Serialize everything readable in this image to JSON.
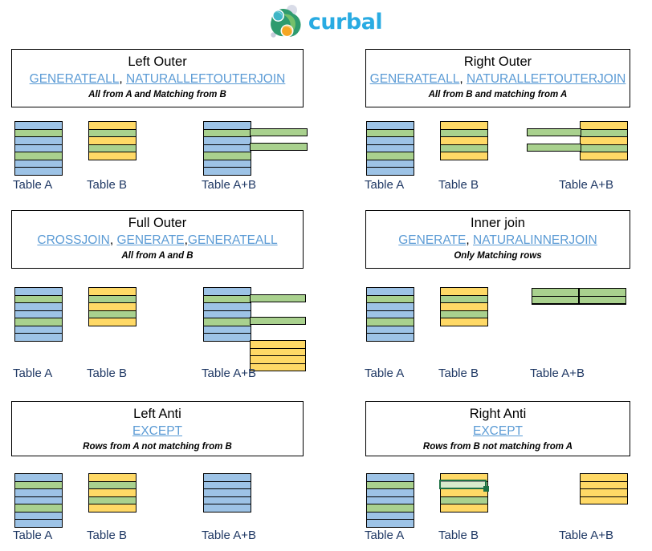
{
  "brand": {
    "name": "curbal",
    "logo_icon": "curbal-logo-icon",
    "text_color": "#29ABE2"
  },
  "palette": {
    "table_a": "#9DC3E6",
    "table_b": "#FFD966",
    "matching": "#A9D18E",
    "link": "#5B9BD5",
    "caption": "#1F3864",
    "selection": "#1E7145"
  },
  "captions": {
    "table_a": "Table A",
    "table_b": "Table B",
    "table_ab": "Table A+B"
  },
  "joins": [
    {
      "id": "left-outer",
      "title": "Left Outer",
      "functions": [
        "GENERATEALL",
        "NATURALLEFTOUTERJOIN"
      ],
      "functions_text": "GENERATEALL, NATURALLEFTOUTERJOIN",
      "description": "All from A and Matching from B",
      "table_a_rows": [
        "blue",
        "green",
        "blue",
        "blue",
        "green",
        "blue",
        "blue"
      ],
      "table_b_rows": [
        "yellow",
        "green",
        "yellow",
        "green",
        "yellow"
      ],
      "result_rows": [
        "blue",
        "green",
        "blue",
        "blue",
        "green",
        "blue",
        "blue"
      ],
      "result_extension_rows": [
        2,
        4
      ],
      "result_extra_block": null
    },
    {
      "id": "right-outer",
      "title": "Right Outer",
      "functions": [
        "GENERATEALL",
        "NATURALLEFTOUTERJOIN"
      ],
      "functions_text": "GENERATEALL, NATURALLEFTOUTERJOIN",
      "description": "All from B and matching from A",
      "table_a_rows": [
        "blue",
        "green",
        "blue",
        "blue",
        "green",
        "blue",
        "blue"
      ],
      "table_b_rows": [
        "yellow",
        "green",
        "yellow",
        "green",
        "yellow"
      ],
      "result_rows": [
        "yellow",
        "green",
        "yellow",
        "green",
        "yellow"
      ],
      "result_extension_rows": [
        2,
        4
      ],
      "result_extra_block": null
    },
    {
      "id": "full-outer",
      "title": "Full Outer",
      "functions": [
        "CROSSJOIN",
        "GENERATE",
        "GENERATEALL"
      ],
      "functions_text": "CROSSJOIN, GENERATE,GENERATEALL",
      "description": "All from A and B",
      "table_a_rows": [
        "blue",
        "green",
        "blue",
        "blue",
        "green",
        "blue",
        "blue"
      ],
      "table_b_rows": [
        "yellow",
        "green",
        "yellow",
        "green",
        "yellow"
      ],
      "result_rows": [
        "blue",
        "green",
        "blue",
        "blue",
        "green",
        "blue",
        "blue"
      ],
      "result_extension_rows": [
        2,
        5
      ],
      "result_extra_block": [
        "yellow",
        "yellow",
        "yellow",
        "yellow"
      ]
    },
    {
      "id": "inner-join",
      "title": "Inner join",
      "functions": [
        "GENERATE",
        "NATURALINNERJOIN"
      ],
      "functions_text": "GENERATE, NATURALINNERJOIN",
      "description": "Only Matching rows",
      "table_a_rows": [
        "blue",
        "green",
        "blue",
        "blue",
        "green",
        "blue",
        "blue"
      ],
      "table_b_rows": [
        "yellow",
        "green",
        "yellow",
        "green",
        "yellow"
      ],
      "result_rows": [
        "green",
        "green"
      ],
      "result_extension_rows": [],
      "result_extra_block": null
    },
    {
      "id": "left-anti",
      "title": "Left Anti",
      "functions": [
        "EXCEPT"
      ],
      "functions_text": "EXCEPT",
      "description": "Rows from A not matching from B",
      "table_a_rows": [
        "blue",
        "green",
        "blue",
        "blue",
        "green",
        "blue",
        "blue"
      ],
      "table_b_rows": [
        "yellow",
        "green",
        "yellow",
        "green",
        "yellow"
      ],
      "result_rows": [
        "blue",
        "blue",
        "blue",
        "blue",
        "blue"
      ],
      "result_extension_rows": [],
      "result_extra_block": null
    },
    {
      "id": "right-anti",
      "title": "Right Anti",
      "functions": [
        "EXCEPT"
      ],
      "functions_text": "EXCEPT",
      "description": "Rows from B not matching from A",
      "table_a_rows": [
        "blue",
        "green",
        "blue",
        "blue",
        "green",
        "blue",
        "blue"
      ],
      "table_b_rows": [
        "yellow",
        "green",
        "yellow",
        "green",
        "yellow"
      ],
      "table_b_selected_row": 2,
      "result_rows": [
        "yellow",
        "yellow",
        "yellow",
        "yellow"
      ],
      "result_extension_rows": [],
      "result_extra_block": null
    }
  ]
}
